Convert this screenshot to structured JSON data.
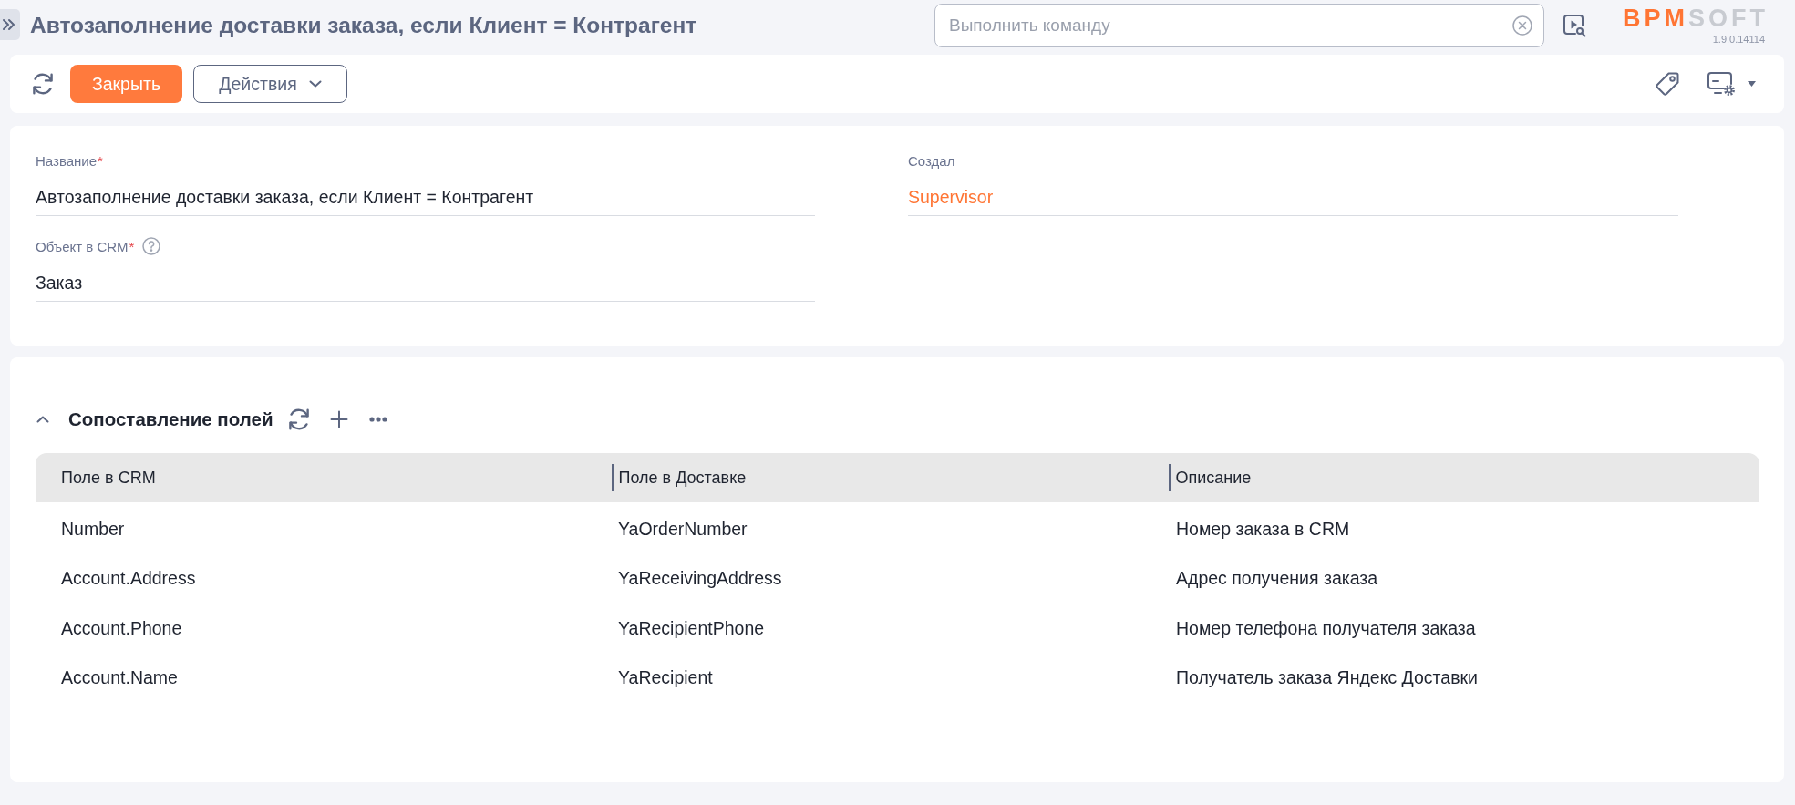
{
  "header": {
    "title": "Автозаполнение доставки заказа, если Клиент = Контрагент",
    "command": {
      "placeholder": "Выполнить команду"
    },
    "logo": {
      "accent": "BPM",
      "rest": "SOFT"
    },
    "version": "1.9.0.14114"
  },
  "toolbar": {
    "buttons": [
      {
        "kind": "primary",
        "label": "Закрыть"
      },
      {
        "kind": "dropdown",
        "label": "Действия"
      }
    ]
  },
  "form": {
    "columns": [
      {
        "fields": [
          {
            "label": "Название",
            "required_mark": "*",
            "help": false,
            "kind": "text",
            "value": "Автозаполнение доставки заказа, если Клиент = Контрагент"
          },
          {
            "label": "Объект в CRM",
            "required_mark": "*",
            "help": true,
            "kind": "text",
            "value": "Заказ"
          }
        ]
      },
      {
        "fields": [
          {
            "label": "Создал",
            "help": false,
            "kind": "link",
            "value": "Supervisor"
          }
        ]
      }
    ]
  },
  "detail": {
    "title": "Сопоставление полей",
    "expanded": true,
    "table": {
      "columns": [
        "Поле в CRM",
        "Поле в Доставке",
        "Описание"
      ],
      "rows": [
        [
          "Number",
          "YaOrderNumber",
          "Номер заказа в CRM"
        ],
        [
          "Account.Address",
          "YaReceivingAddress",
          "Адрес получения заказа"
        ],
        [
          "Account.Phone",
          "YaRecipientPhone",
          "Номер телефона получателя заказа"
        ],
        [
          "Account.Name",
          "YaRecipient",
          "Получатель заказа Яндекс Доставки"
        ]
      ]
    }
  }
}
